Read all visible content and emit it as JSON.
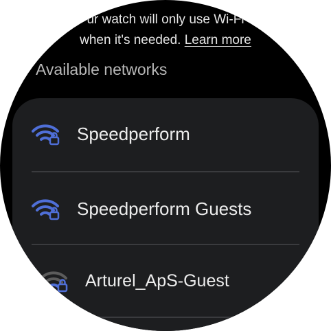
{
  "header": {
    "description_line1": "ur watch will only use Wi-Fi",
    "description_line2_prefix": "when it's needed.",
    "learn_more": "Learn more"
  },
  "section": {
    "title": "Available networks"
  },
  "networks": [
    {
      "name": "Speedperform",
      "icon": "wifi-lock-icon",
      "signal": "full"
    },
    {
      "name": "Speedperform Guests",
      "icon": "wifi-lock-icon",
      "signal": "full"
    },
    {
      "name": "Arturel_ApS-Guest",
      "icon": "wifi-lock-icon",
      "signal": "weak"
    }
  ],
  "colors": {
    "background": "#000000",
    "card": "#1d1e20",
    "wifi_blue": "#4f6fd8",
    "wifi_dim": "#5c5c5c"
  }
}
